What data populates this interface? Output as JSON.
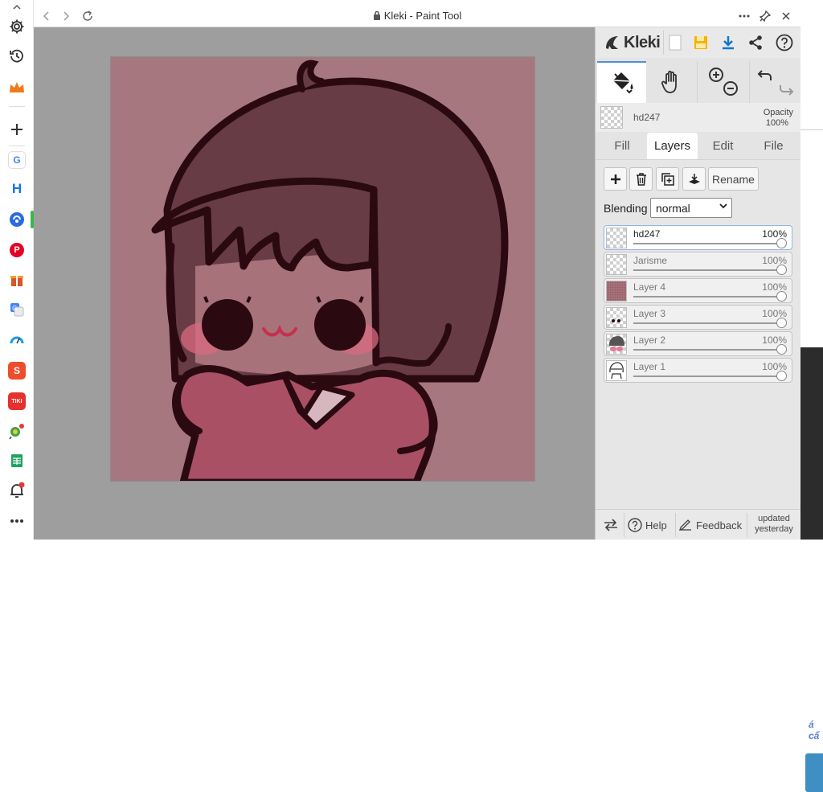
{
  "window": {
    "title": "Kleki - Paint Tool"
  },
  "browser_sidebar": {
    "icons": [
      "settings-icon",
      "history-icon",
      "crown-icon",
      "add-icon",
      "google-icon",
      "h-app-icon",
      "translate-app-icon",
      "pinterest-icon",
      "gift-app-icon",
      "google-translate-icon",
      "speedtest-icon",
      "shopee-icon",
      "tiki-icon",
      "lollipop-app-icon",
      "sheets-icon",
      "notification-bell-icon",
      "more-icon"
    ],
    "fav_labels": {
      "google": "G",
      "h": "H",
      "shopee": "S",
      "tiki": "TIKI",
      "pinterest": "P"
    }
  },
  "kleki": {
    "logo_text": "Kleki",
    "current_layer_name": "hd247",
    "opacity_label": "Opacity",
    "opacity_value": "100%",
    "tabs": [
      {
        "label": "Fill",
        "active": false
      },
      {
        "label": "Layers",
        "active": true
      },
      {
        "label": "Edit",
        "active": false
      },
      {
        "label": "File",
        "active": false
      }
    ],
    "rename_label": "Rename",
    "blending_label": "Blending",
    "blending_value": "normal",
    "layers": [
      {
        "name": "hd247",
        "opacity": "100%",
        "selected": true
      },
      {
        "name": "Jarisme",
        "opacity": "100%",
        "selected": false
      },
      {
        "name": "Layer 4",
        "opacity": "100%",
        "selected": false
      },
      {
        "name": "Layer 3",
        "opacity": "100%",
        "selected": false
      },
      {
        "name": "Layer 2",
        "opacity": "100%",
        "selected": false
      },
      {
        "name": "Layer 1",
        "opacity": "100%",
        "selected": false
      }
    ],
    "footer": {
      "help_label": "Help",
      "feedback_label": "Feedback",
      "updated_line1": "updated",
      "updated_line2": "yesterday"
    }
  },
  "background_page": {
    "text": "á cẩ"
  },
  "colors": {
    "canvas_bg": "#a7777f",
    "hair": "#683c45",
    "outline": "#2a0a10",
    "face": "#a8727a",
    "shirt": "#a95065",
    "blush": "#d96a82",
    "accent_blue": "#1177cc",
    "save_yellow": "#f4b400"
  }
}
